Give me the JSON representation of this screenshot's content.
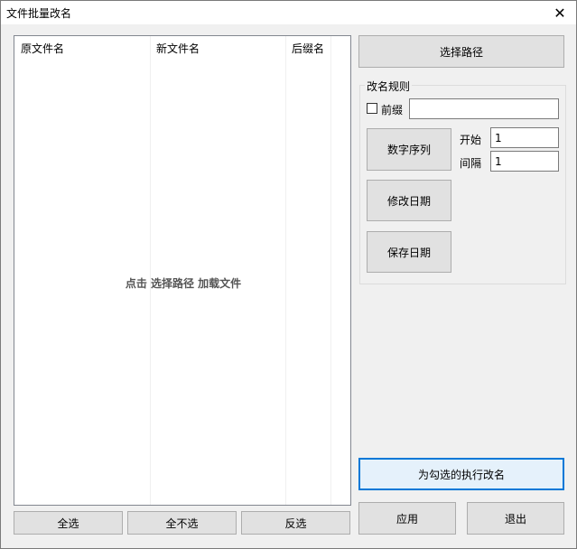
{
  "window": {
    "title": "文件批量改名",
    "close_glyph": "✕"
  },
  "list": {
    "columns": [
      "原文件名",
      "新文件名",
      "后缀名"
    ],
    "empty_hint": "点击 选择路径 加载文件"
  },
  "buttons": {
    "select_path": "选择路径",
    "number_sequence": "数字序列",
    "modify_date": "修改日期",
    "save_date": "保存日期",
    "rename_checked": "为勾选的执行改名",
    "select_all": "全选",
    "select_none": "全不选",
    "invert": "反选",
    "apply": "应用",
    "exit": "退出"
  },
  "rules": {
    "group_title": "改名规则",
    "prefix_label": "前缀",
    "prefix_checked": false,
    "prefix_value": "",
    "start_label": "开始",
    "start_value": "1",
    "interval_label": "间隔",
    "interval_value": "1"
  }
}
